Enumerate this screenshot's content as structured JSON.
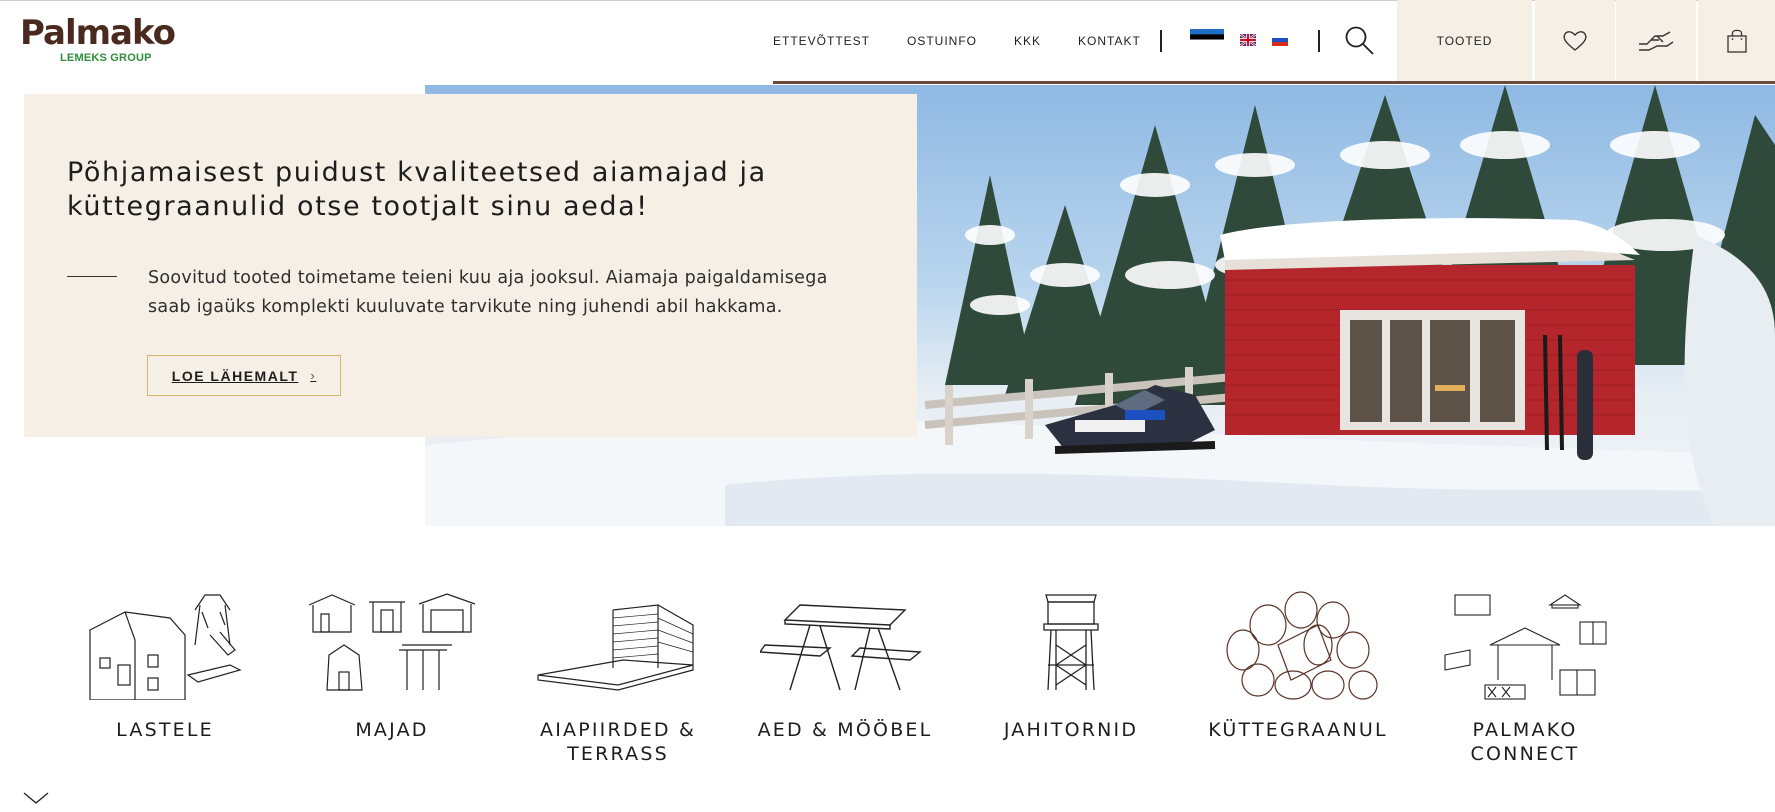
{
  "brand": {
    "name": "Palmako",
    "subtitle": "LEMEKS GROUP",
    "color_brown": "#4a2a1f",
    "color_green": "#2f8f3b"
  },
  "nav": {
    "items": [
      "ETTEVÕTTEST",
      "OSTUINFO",
      "KKK",
      "KONTAKT"
    ],
    "languages": [
      "et",
      "en",
      "ru"
    ],
    "products_label": "TOOTED",
    "icons": {
      "search": "search-icon",
      "favorites": "heart-icon",
      "connect": "handshake-icon",
      "cart": "shopping-bag-icon"
    }
  },
  "hero": {
    "title": "Põhjamaisest puidust kvaliteetsed aiamajad ja küttegraanulid otse tootjalt sinu aeda!",
    "description": "Soovitud tooted toimetame teieni kuu aja jooksul. Aiamaja paigaldamisega saab igaüks komplekti kuuluvate tarvikute ning juhendi abil hakkama.",
    "button_label": "LOE LÄHEMALT",
    "button_chevron": "›",
    "panel_color": "#f6efe6",
    "button_border_color": "#d4b76a"
  },
  "categories": [
    {
      "label": "LASTELE",
      "icon": "playhouse-icon"
    },
    {
      "label": "MAJAD",
      "icon": "houses-icon"
    },
    {
      "label": "AIAPIIRDED & TERRASS",
      "icon": "fence-terrace-icon"
    },
    {
      "label": "AED & MÖÖBEL",
      "icon": "picnic-table-icon"
    },
    {
      "label": "JAHITORNID",
      "icon": "hunting-tower-icon"
    },
    {
      "label": "KÜTTEGRAANUL",
      "icon": "logs-icon"
    },
    {
      "label": "PALMAKO CONNECT",
      "icon": "connect-structures-icon"
    }
  ],
  "scroll_indicator": "chevron-down-icon"
}
